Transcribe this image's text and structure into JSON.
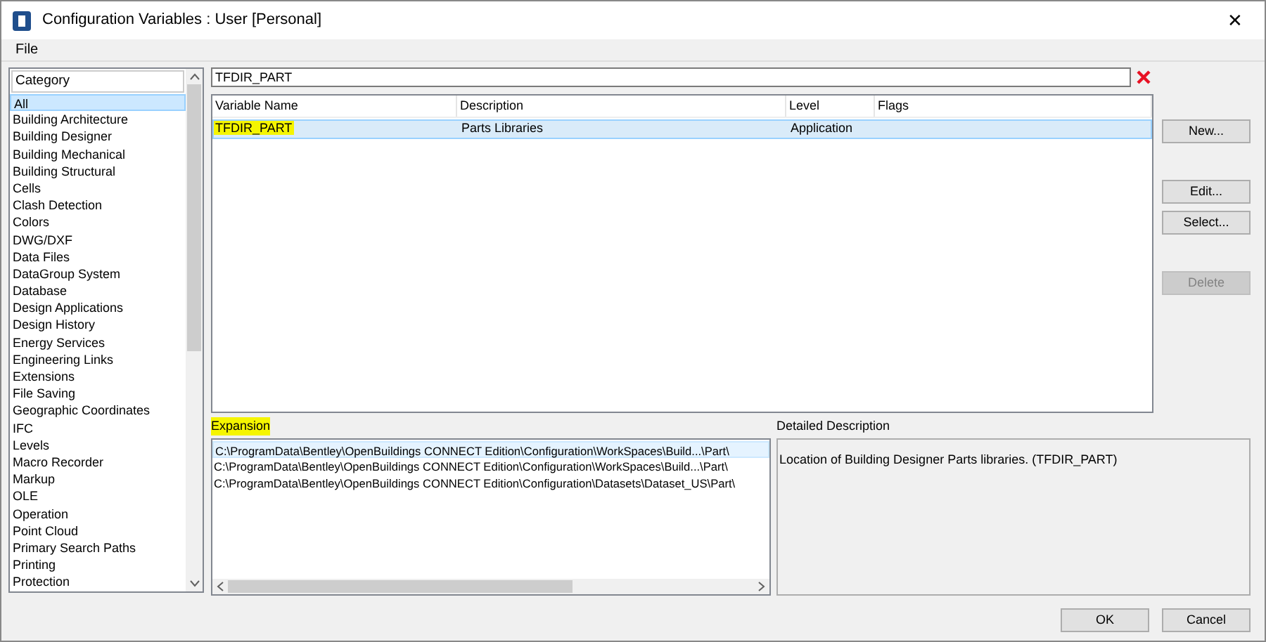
{
  "window": {
    "title": "Configuration Variables : User [Personal]",
    "close": "✕"
  },
  "menu": [
    "File"
  ],
  "category": {
    "header": "Category",
    "items": [
      {
        "label": "All",
        "selected": true
      },
      {
        "label": "Building Architecture",
        "selected": false
      },
      {
        "label": "Building Designer",
        "selected": false
      },
      {
        "label": "Building Mechanical",
        "selected": false
      },
      {
        "label": "Building Structural",
        "selected": false
      },
      {
        "label": "Cells",
        "selected": false
      },
      {
        "label": "Clash Detection",
        "selected": false
      },
      {
        "label": "Colors",
        "selected": false
      },
      {
        "label": "DWG/DXF",
        "selected": false
      },
      {
        "label": "Data Files",
        "selected": false
      },
      {
        "label": "DataGroup System",
        "selected": false
      },
      {
        "label": "Database",
        "selected": false
      },
      {
        "label": "Design Applications",
        "selected": false
      },
      {
        "label": "Design History",
        "selected": false
      },
      {
        "label": "Energy Services",
        "selected": false
      },
      {
        "label": "Engineering Links",
        "selected": false
      },
      {
        "label": "Extensions",
        "selected": false
      },
      {
        "label": "File Saving",
        "selected": false
      },
      {
        "label": "Geographic Coordinates",
        "selected": false
      },
      {
        "label": "IFC",
        "selected": false
      },
      {
        "label": "Levels",
        "selected": false
      },
      {
        "label": "Macro Recorder",
        "selected": false
      },
      {
        "label": "Markup",
        "selected": false
      },
      {
        "label": "OLE",
        "selected": false
      },
      {
        "label": "Operation",
        "selected": false
      },
      {
        "label": "Point Cloud",
        "selected": false
      },
      {
        "label": "Primary Search Paths",
        "selected": false
      },
      {
        "label": "Printing",
        "selected": false
      },
      {
        "label": "Protection",
        "selected": false
      }
    ]
  },
  "search": {
    "value": "TFDIR_PART"
  },
  "table": {
    "columns": [
      "Variable Name",
      "Description",
      "Level",
      "Flags"
    ],
    "rows": [
      {
        "name": "TFDIR_PART",
        "description": "Parts Libraries",
        "level_text": "Application",
        "selected": true,
        "highlighted": true
      }
    ]
  },
  "buttons": [
    {
      "label": "New...",
      "disabled": false
    },
    {
      "label": "Edit...",
      "disabled": false
    },
    {
      "label": "Select...",
      "disabled": false
    },
    {
      "label": "Delete",
      "disabled": true
    }
  ],
  "expansion": {
    "label": "Expansion",
    "highlighted": true,
    "items": [
      {
        "text": "C:\\ProgramData\\Bentley\\OpenBuildings CONNECT Edition\\Configuration\\WorkSpaces\\Build...\\Part\\",
        "selected": true
      },
      {
        "text": "C:\\ProgramData\\Bentley\\OpenBuildings CONNECT Edition\\Configuration\\WorkSpaces\\Build...\\Part\\",
        "selected": false
      },
      {
        "text": "C:\\ProgramData\\Bentley\\OpenBuildings CONNECT Edition\\Configuration\\Datasets\\Dataset_US\\Part\\",
        "selected": false
      }
    ]
  },
  "detailed_description": {
    "label": "Detailed Description",
    "text": "Location of Building Designer Parts libraries. (TFDIR_PART)"
  },
  "footer_buttons": [
    "OK",
    "Cancel"
  ]
}
